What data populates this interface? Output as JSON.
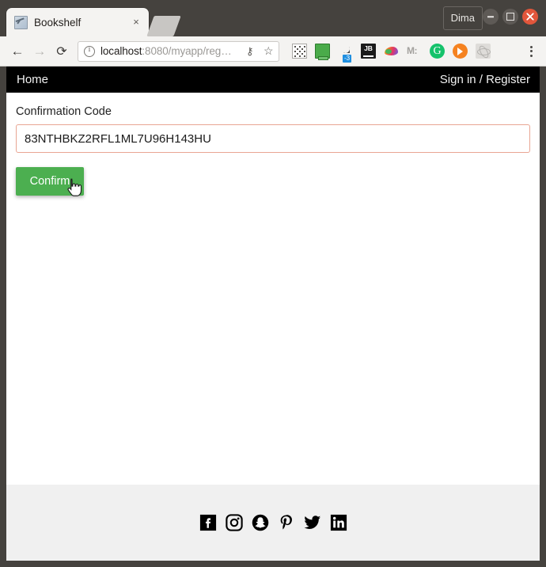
{
  "browser": {
    "tab": {
      "title": "Bookshelf",
      "favicon_name": "broken-image-favicon",
      "close_label": "×"
    },
    "new_tab_label": "+",
    "profile_name": "Dima",
    "window_controls": {
      "minimize": "minimize",
      "maximize": "maximize",
      "close": "close"
    },
    "nav": {
      "back": "←",
      "forward": "→",
      "reload": "⟳"
    },
    "omnibox": {
      "security_icon": "info-icon",
      "url_host": "localhost",
      "url_rest": ":8080/myapp/reg…",
      "key_icon": "⚷",
      "star_icon": "☆"
    },
    "extensions": [
      {
        "name": "qr-code-extension-icon",
        "label": ""
      },
      {
        "name": "screen-share-extension-icon",
        "label": ""
      },
      {
        "name": "dark-mode-moon-extension-icon",
        "label": "-3"
      },
      {
        "name": "jetbrains-extension-icon",
        "label": "JB"
      },
      {
        "name": "colorful-bird-extension-icon",
        "label": ""
      },
      {
        "name": "momentum-extension-icon",
        "label": "M:"
      },
      {
        "name": "grammarly-extension-icon",
        "label": "G"
      },
      {
        "name": "orange-arrow-extension-icon",
        "label": ""
      },
      {
        "name": "react-devtools-extension-icon",
        "label": ""
      }
    ],
    "menu_label": "⋮"
  },
  "page": {
    "nav": {
      "home": "Home",
      "signin_register": "Sign in / Register"
    },
    "form": {
      "label": "Confirmation Code",
      "code_value": "83NTHBKZ2RFL1ML7U96H143HU",
      "code_placeholder": "",
      "confirm_label": "Confirm"
    },
    "footer": {
      "social": [
        {
          "name": "facebook-icon"
        },
        {
          "name": "instagram-icon"
        },
        {
          "name": "snapchat-icon"
        },
        {
          "name": "pinterest-icon"
        },
        {
          "name": "twitter-icon"
        },
        {
          "name": "linkedin-icon"
        }
      ]
    }
  },
  "colors": {
    "navbar": "#000000",
    "button_green": "#4caf50",
    "input_border": "#e9a593",
    "footer_bg": "#f0f0f0",
    "chrome_frame": "#45423e"
  }
}
